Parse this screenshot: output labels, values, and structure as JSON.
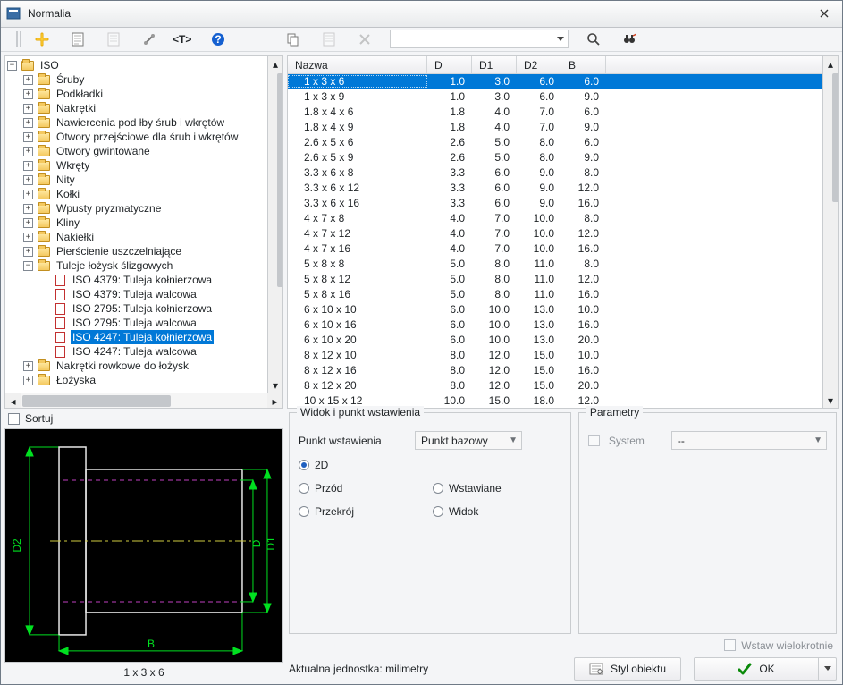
{
  "window": {
    "title": "Normalia"
  },
  "toolbar": {},
  "tree": {
    "root": "ISO",
    "items": [
      {
        "label": "Śruby",
        "icon": "folder",
        "toggle": "+"
      },
      {
        "label": "Podkładki",
        "icon": "folder",
        "toggle": "+"
      },
      {
        "label": "Nakrętki",
        "icon": "folder",
        "toggle": "+"
      },
      {
        "label": "Nawiercenia pod łby śrub i wkrętów",
        "icon": "folder",
        "toggle": "+"
      },
      {
        "label": "Otwory przejściowe dla śrub i wkrętów",
        "icon": "folder",
        "toggle": "+"
      },
      {
        "label": "Otwory gwintowane",
        "icon": "folder",
        "toggle": "+"
      },
      {
        "label": "Wkręty",
        "icon": "folder",
        "toggle": "+"
      },
      {
        "label": "Nity",
        "icon": "folder",
        "toggle": "+"
      },
      {
        "label": "Kołki",
        "icon": "folder",
        "toggle": "+"
      },
      {
        "label": "Wpusty pryzmatyczne",
        "icon": "folder",
        "toggle": "+"
      },
      {
        "label": "Kliny",
        "icon": "folder",
        "toggle": "+"
      },
      {
        "label": "Nakiełki",
        "icon": "folder",
        "toggle": "+"
      },
      {
        "label": "Pierścienie uszczelniające",
        "icon": "folder",
        "toggle": "+"
      },
      {
        "label": "Tuleje łożysk ślizgowych",
        "icon": "folder",
        "toggle": "-"
      }
    ],
    "tuleje_children": [
      {
        "label": "ISO 4379: Tuleja kołnierzowa"
      },
      {
        "label": "ISO 4379: Tuleja walcowa"
      },
      {
        "label": "ISO 2795: Tuleja kołnierzowa"
      },
      {
        "label": "ISO 2795: Tuleja walcowa"
      },
      {
        "label": "ISO 4247: Tuleja kołnierzowa",
        "selected": true
      },
      {
        "label": "ISO 4247: Tuleja walcowa"
      }
    ],
    "tail": [
      {
        "label": "Nakrętki rowkowe do łożysk",
        "icon": "folder",
        "toggle": "+"
      },
      {
        "label": "Łożyska",
        "icon": "folder",
        "toggle": "+"
      }
    ]
  },
  "table": {
    "columns": [
      "Nazwa",
      "D",
      "D1",
      "D2",
      "B"
    ],
    "rows": [
      {
        "name": "1 x 3 x 6",
        "D": "1.0",
        "D1": "3.0",
        "D2": "6.0",
        "B": "6.0",
        "selected": true
      },
      {
        "name": "1 x 3 x 9",
        "D": "1.0",
        "D1": "3.0",
        "D2": "6.0",
        "B": "9.0"
      },
      {
        "name": "1.8 x 4 x 6",
        "D": "1.8",
        "D1": "4.0",
        "D2": "7.0",
        "B": "6.0"
      },
      {
        "name": "1.8 x 4 x 9",
        "D": "1.8",
        "D1": "4.0",
        "D2": "7.0",
        "B": "9.0"
      },
      {
        "name": "2.6 x 5 x 6",
        "D": "2.6",
        "D1": "5.0",
        "D2": "8.0",
        "B": "6.0"
      },
      {
        "name": "2.6 x 5 x 9",
        "D": "2.6",
        "D1": "5.0",
        "D2": "8.0",
        "B": "9.0"
      },
      {
        "name": "3.3 x 6 x 8",
        "D": "3.3",
        "D1": "6.0",
        "D2": "9.0",
        "B": "8.0"
      },
      {
        "name": "3.3 x 6 x 12",
        "D": "3.3",
        "D1": "6.0",
        "D2": "9.0",
        "B": "12.0"
      },
      {
        "name": "3.3 x 6 x 16",
        "D": "3.3",
        "D1": "6.0",
        "D2": "9.0",
        "B": "16.0"
      },
      {
        "name": "4 x 7 x 8",
        "D": "4.0",
        "D1": "7.0",
        "D2": "10.0",
        "B": "8.0"
      },
      {
        "name": "4 x 7 x 12",
        "D": "4.0",
        "D1": "7.0",
        "D2": "10.0",
        "B": "12.0"
      },
      {
        "name": "4 x 7 x 16",
        "D": "4.0",
        "D1": "7.0",
        "D2": "10.0",
        "B": "16.0"
      },
      {
        "name": "5 x 8 x 8",
        "D": "5.0",
        "D1": "8.0",
        "D2": "11.0",
        "B": "8.0"
      },
      {
        "name": "5 x 8 x 12",
        "D": "5.0",
        "D1": "8.0",
        "D2": "11.0",
        "B": "12.0"
      },
      {
        "name": "5 x 8 x 16",
        "D": "5.0",
        "D1": "8.0",
        "D2": "11.0",
        "B": "16.0"
      },
      {
        "name": "6 x 10 x 10",
        "D": "6.0",
        "D1": "10.0",
        "D2": "13.0",
        "B": "10.0"
      },
      {
        "name": "6 x 10 x 16",
        "D": "6.0",
        "D1": "10.0",
        "D2": "13.0",
        "B": "16.0"
      },
      {
        "name": "6 x 10 x 20",
        "D": "6.0",
        "D1": "10.0",
        "D2": "13.0",
        "B": "20.0"
      },
      {
        "name": "8 x 12 x 10",
        "D": "8.0",
        "D1": "12.0",
        "D2": "15.0",
        "B": "10.0"
      },
      {
        "name": "8 x 12 x 16",
        "D": "8.0",
        "D1": "12.0",
        "D2": "15.0",
        "B": "16.0"
      },
      {
        "name": "8 x 12 x 20",
        "D": "8.0",
        "D1": "12.0",
        "D2": "15.0",
        "B": "20.0"
      },
      {
        "name": "10 x 15 x 12",
        "D": "10.0",
        "D1": "15.0",
        "D2": "18.0",
        "B": "12.0"
      }
    ]
  },
  "sort": {
    "label": "Sortuj",
    "checked": false
  },
  "preview": {
    "caption": "1 x 3 x 6",
    "dims": {
      "B": "B",
      "D": "D",
      "D1": "D1",
      "D2": "D2"
    }
  },
  "view_group": {
    "legend": "Widok i punkt wstawienia",
    "point_label": "Punkt wstawienia",
    "point_value": "Punkt bazowy",
    "opt_2d": "2D",
    "opt_front": "Przód",
    "opt_inserted": "Wstawiane",
    "opt_section": "Przekrój",
    "opt_view": "Widok"
  },
  "param_group": {
    "legend": "Parametry",
    "system_label": "System",
    "system_value": "--"
  },
  "footer": {
    "unit_label": "Aktualna jednostka: milimetry",
    "style_label": "Styl obiektu",
    "insert_many_label": "Wstaw wielokrotnie",
    "ok_label": "OK"
  }
}
